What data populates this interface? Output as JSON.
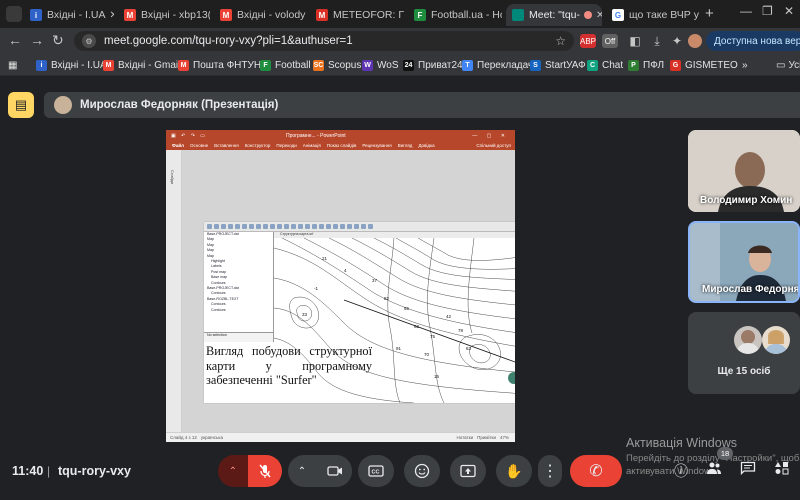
{
  "browser": {
    "tabs": [
      {
        "title": "Вхідні - I.UA",
        "favicon_color": "#2f62c8",
        "favicon_glyph": "i"
      },
      {
        "title": "Вхідні - xbp13(",
        "favicon_color": "#ea4335",
        "favicon_glyph": "M"
      },
      {
        "title": "Вхідні - volodyr",
        "favicon_color": "#ea4335",
        "favicon_glyph": "M"
      },
      {
        "title": "METEOFOR: Пог",
        "favicon_color": "#d93025",
        "favicon_glyph": "M"
      },
      {
        "title": "Football.ua - Но",
        "favicon_color": "#1e8e3e",
        "favicon_glyph": "F"
      },
      {
        "title": "Meet: \"tqu-",
        "favicon_color": "#00897b",
        "favicon_glyph": "",
        "active": true
      },
      {
        "title": "що таке ВЧР у",
        "favicon_color": "#ffffff",
        "favicon_glyph": "G"
      }
    ],
    "new_tab_glyph": "+",
    "url": "meet.google.com/tqu-rory-vxy?pli=1&authuser=1",
    "update_text": "Доступна нова версія Chrome",
    "extensions": [
      {
        "label": "ABP",
        "color": "#d32f2f"
      },
      {
        "label": "Off",
        "color": "#616161"
      }
    ],
    "bookmarks": [
      {
        "label": "Вхідні - I.UA",
        "color": "#2f62c8",
        "glyph": "i"
      },
      {
        "label": "Вхідні - Gmail",
        "color": "#ea4335",
        "glyph": "M"
      },
      {
        "label": "Пошта ФНТУНГ",
        "color": "#ea4335",
        "glyph": "M"
      },
      {
        "label": "Football",
        "color": "#1e8e3e",
        "glyph": "F"
      },
      {
        "label": "Scopus",
        "color": "#e9711c",
        "glyph": "SC"
      },
      {
        "label": "WoS",
        "color": "#5e35b1",
        "glyph": "W"
      },
      {
        "label": "Приват24",
        "color": "#111111",
        "glyph": "24"
      },
      {
        "label": "Перекладач",
        "color": "#4285f4",
        "glyph": "T"
      },
      {
        "label": "StartУАФ",
        "color": "#1565c0",
        "glyph": "S"
      },
      {
        "label": "Chat",
        "color": "#10a37f",
        "glyph": "C"
      },
      {
        "label": "ПФЛ",
        "color": "#2e7d32",
        "glyph": "P"
      },
      {
        "label": "GISMETEO",
        "color": "#d93025",
        "glyph": "G"
      }
    ],
    "bookmarks_overflow": "»",
    "other_folder": "Усі"
  },
  "meet": {
    "presenter_label": "Мирослав Федорняк (Презентація)",
    "time": "11:40",
    "meeting_code": "tqu-rory-vxy",
    "participants": [
      {
        "name": "Володимир Хомин"
      },
      {
        "name": "Мирослав Федорняк"
      }
    ],
    "others_label": "Ще 15 осіб",
    "participant_count": "18",
    "controls": {
      "raise_hand": "✋",
      "more": "⋮",
      "end_call": "✆"
    }
  },
  "presentation": {
    "app_title": "Програмне...  - PowerPoint",
    "ribbon_tabs": [
      "Файл",
      "Основне",
      "Вставлення",
      "Конструктор",
      "Переходи",
      "Анімація",
      "Показ слайдів",
      "Рецензування",
      "Вигляд",
      "Довідка"
    ],
    "share_label": "Спільний доступ",
    "thumbnails_label": "Слайди",
    "status_left": "Слайд 4 з 12",
    "status_lang": "українська",
    "status_notes": "Нотатки",
    "status_comments": "Примітки",
    "status_zoom": "47%",
    "slide_caption": "Вигляд побудови структурної карти у програмному забезпеченні \"Surfer\"",
    "surfer_tree": [
      "Base-PROJECT.dat",
      "Map",
      "Map",
      "Map",
      "Map",
      "Highlight",
      "Labels",
      "Post map",
      "Base map",
      "Contours",
      "Base-PROJECT.dat",
      "Contours",
      "Base-ROZBL.TEXT",
      "Contours",
      "Contours"
    ],
    "surfer_props_label": "No selection",
    "surfer_tab_label": "Структурна карта.srf",
    "contour_labels": [
      "21",
      "-1",
      "33",
      "82",
      "55",
      "62",
      "75",
      "42",
      "78",
      "63",
      "70",
      "15",
      "37",
      "91",
      "4"
    ]
  },
  "colors": {
    "meet_bg": "#202124",
    "powerpoint_red": "#b7472a",
    "end_call_red": "#ea4335",
    "presenter_yellow": "#fdd663",
    "active_speaker_blue": "#8ab4f8"
  },
  "watermark": {
    "line1": "Активація Windows",
    "line2": "Перейдіть до розділу \"Настройки\", щоб",
    "line3": "активувати Windows."
  }
}
